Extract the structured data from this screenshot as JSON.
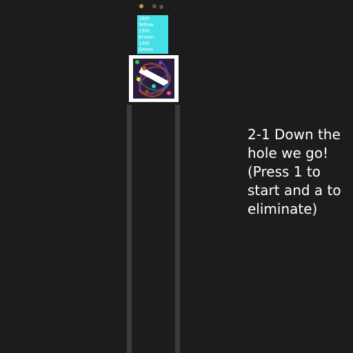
{
  "ranking": {
    "lines": [
      "16th",
      "Yellow",
      "15th",
      "Brown",
      "14th",
      "Green"
    ],
    "background_color": "#45e0e6"
  },
  "level": {
    "lines": [
      "2-1 Down the",
      "hole we go!",
      "(Press 1 to",
      "start and a to",
      "eliminate)"
    ]
  },
  "colors": {
    "background": "#1c1c1c",
    "tube": "#3b3b3b",
    "frame": "#ffffff",
    "arena": "#2a1d3c"
  },
  "top_marbles": [
    {
      "color": "#c8915a",
      "icon": "marble-icon"
    },
    {
      "color": "#6b5a2a",
      "icon": "marble-icon"
    },
    {
      "color": "#555555",
      "icon": "marble-icon"
    }
  ],
  "arena_marbles": [
    {
      "color": "#2ad12a"
    },
    {
      "color": "#d14a2a"
    },
    {
      "color": "#7a3fd6"
    },
    {
      "color": "#e6e22a"
    },
    {
      "color": "#2a5ad6"
    },
    {
      "color": "#ff4a8a"
    },
    {
      "color": "#8a4a1a"
    },
    {
      "color": "#2ad6c8"
    }
  ]
}
